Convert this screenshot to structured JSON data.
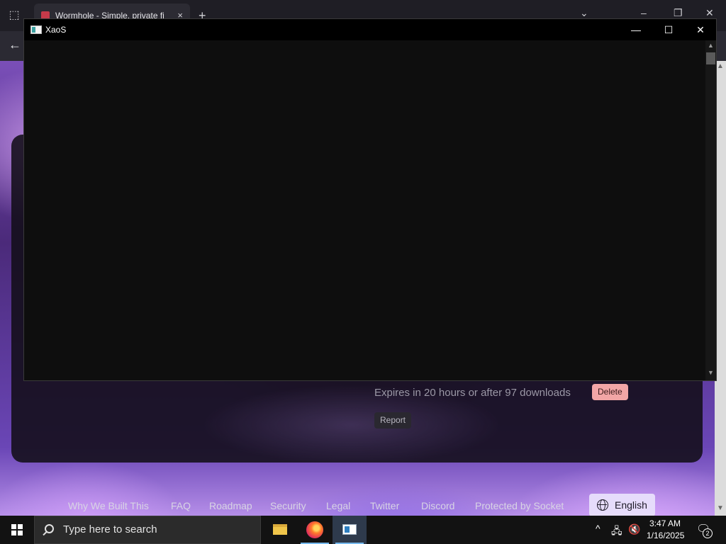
{
  "browser": {
    "tab_title": "Wormhole - Simple, private fi",
    "tab_close": "×",
    "new_tab": "+",
    "tab_list": "⬚",
    "back": "←",
    "chevron": "⌄",
    "min": "–",
    "restore": "❐",
    "close": "✕"
  },
  "page": {
    "expires_text": "Expires in 20 hours or after 97 downloads",
    "delete_label": "Delete",
    "report_label": "Report",
    "footer_links": [
      "Why We Built This",
      "FAQ",
      "Roadmap",
      "Security",
      "Legal",
      "Twitter",
      "Discord",
      "Protected by Socket"
    ],
    "language_label": "English"
  },
  "xaos": {
    "title": "XaoS",
    "minimize": "—",
    "maximize": "☐",
    "close": "✕",
    "scroll_up": "▲",
    "scroll_down": "▼"
  },
  "taskbar": {
    "search_placeholder": "Type here to search",
    "time": "3:47 AM",
    "date": "1/16/2025",
    "notification_count": "2",
    "tray_chevron": "^"
  }
}
